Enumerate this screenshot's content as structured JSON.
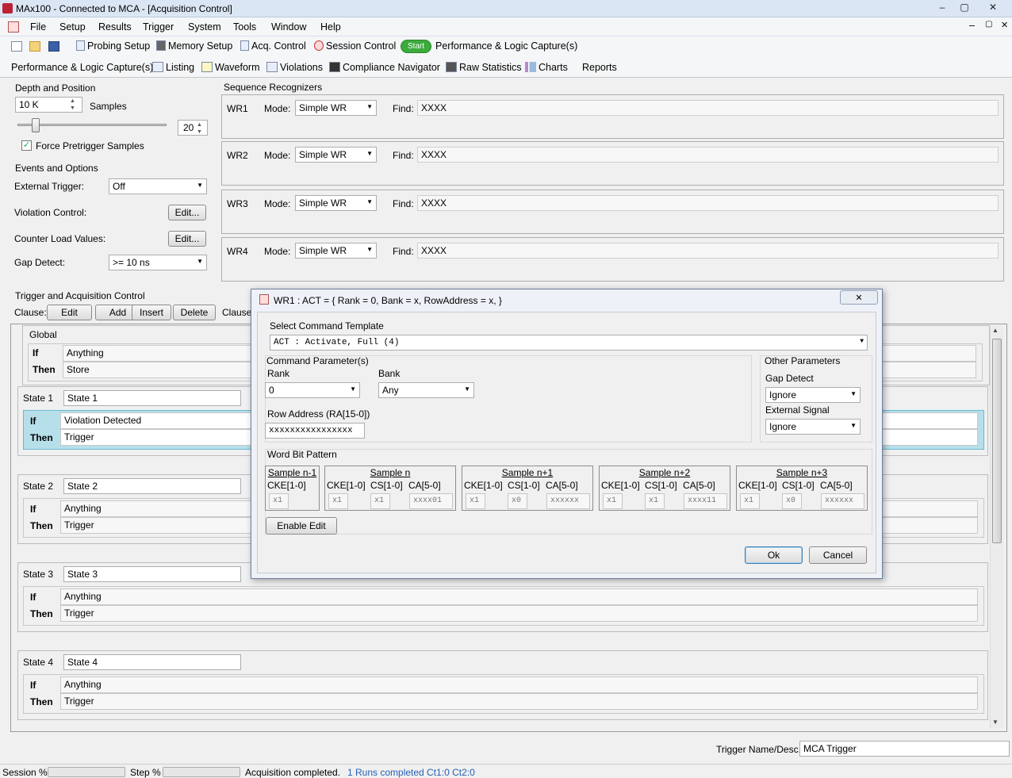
{
  "window": {
    "title": "MAx100 - Connected to MCA - [Acquisition Control]",
    "minimize": "‒",
    "maximize": "▢",
    "close": "✕"
  },
  "menu": [
    "File",
    "Setup",
    "Results",
    "Trigger",
    "System",
    "Tools",
    "Window",
    "Help"
  ],
  "toolbar1": {
    "probing": "Probing Setup",
    "memory": "Memory Setup",
    "acq": "Acq. Control",
    "session": "Session Control",
    "start": "Start",
    "perf": "Performance & Logic Capture(s)"
  },
  "toolbar2": {
    "perf": "Performance & Logic Capture(s)",
    "listing": "Listing",
    "waveform": "Waveform",
    "violations": "Violations",
    "compliance": "Compliance Navigator",
    "raw": "Raw Statistics",
    "charts": "Charts",
    "reports": "Reports"
  },
  "depth": {
    "title": "Depth and Position",
    "value": "10 K",
    "samples_label": "Samples",
    "slider_value": "20",
    "slider_level": 0.12,
    "force_label": "Force Pretrigger Samples",
    "force_checked": true
  },
  "events": {
    "title": "Events and Options",
    "ext_trigger_label": "External Trigger:",
    "ext_trigger_value": "Off",
    "violation_label": "Violation Control:",
    "counter_label": "Counter Load Values:",
    "edit": "Edit...",
    "gap_label": "Gap Detect:",
    "gap_value": ">= 10 ns"
  },
  "seq": {
    "title": "Sequence Recognizers",
    "mode_label": "Mode:",
    "find_label": "Find:",
    "items": [
      {
        "name": "WR1",
        "mode": "Simple WR",
        "find": "XXXX"
      },
      {
        "name": "WR2",
        "mode": "Simple WR",
        "find": "XXXX"
      },
      {
        "name": "WR3",
        "mode": "Simple WR",
        "find": "XXXX"
      },
      {
        "name": "WR4",
        "mode": "Simple WR",
        "find": "XXXX"
      }
    ]
  },
  "trigger": {
    "title": "Trigger and Acquisition Control",
    "clause_label": "Clause:",
    "edit": "Edit",
    "add": "Add",
    "insert": "Insert",
    "delete": "Delete",
    "clause2": "Clause",
    "global": "Global",
    "if": "If",
    "then": "Then",
    "global_if": "Anything",
    "global_then": "Store",
    "states": [
      {
        "label": "State 1",
        "name": "State 1",
        "if": "Violation Detected",
        "then": "Trigger"
      },
      {
        "label": "State 2",
        "name": "State 2",
        "if": "Anything",
        "then": "Trigger"
      },
      {
        "label": "State 3",
        "name": "State 3",
        "if": "Anything",
        "then": "Trigger"
      },
      {
        "label": "State 4",
        "name": "State 4",
        "if": "Anything",
        "then": "Trigger"
      }
    ]
  },
  "dialog": {
    "title": "WR1 : ACT = { Rank = 0, Bank = x, RowAddress = x,  }",
    "template_label": "Select Command Template",
    "template_value": "ACT : Activate, Full     (4)",
    "cmd_params": "Command Parameter(s)",
    "rank_label": "Rank",
    "rank_value": "0",
    "bank_label": "Bank",
    "bank_value": "Any",
    "row_label": "Row Address (RA[15-0])",
    "row_value": "xxxxxxxxxxxxxxxx",
    "other": "Other Parameters",
    "gap_label": "Gap Detect",
    "gap_value": "Ignore",
    "ext_label": "External Signal",
    "ext_value": "Ignore",
    "wbp": "Word Bit Pattern",
    "cke": "CKE[1-0]",
    "cs": "CS[1-0]",
    "ca": "CA[5-0]",
    "samples": [
      {
        "name": "Sample n-1",
        "cke": "x1"
      },
      {
        "name": "Sample n",
        "cke": "x1",
        "cs": "x1",
        "ca": "xxxx01"
      },
      {
        "name": "Sample n+1",
        "cke": "x1",
        "cs": "x0",
        "ca": "xxxxxx"
      },
      {
        "name": "Sample n+2",
        "cke": "x1",
        "cs": "x1",
        "ca": "xxxx11"
      },
      {
        "name": "Sample n+3",
        "cke": "x1",
        "cs": "x0",
        "ca": "xxxxxx"
      }
    ],
    "enable_edit": "Enable Edit",
    "ok": "Ok",
    "cancel": "Cancel"
  },
  "footer": {
    "trig_label": "Trigger Name/Desc.",
    "trig_value": "MCA Trigger"
  },
  "status": {
    "session": "Session %",
    "step": "Step %",
    "msg": "Acquisition completed.",
    "runs": "1 Runs completed Ct1:0 Ct2:0"
  }
}
